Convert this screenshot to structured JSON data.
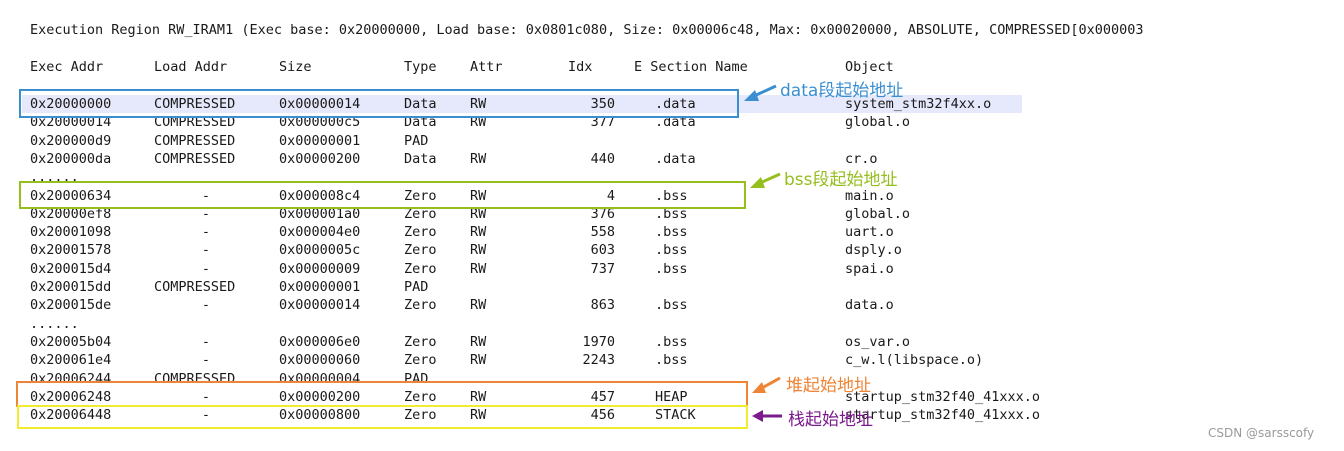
{
  "region_line": "Execution Region RW_IRAM1 (Exec base: 0x20000000, Load base: 0x0801c080, Size: 0x00006c48, Max: 0x00020000, ABSOLUTE, COMPRESSED[0x000003",
  "headers": [
    "Exec Addr",
    "Load Addr",
    "Size",
    "Type",
    "Attr",
    "Idx",
    "E Section Name",
    "Object"
  ],
  "rows": [
    {
      "exec": "0x20000000",
      "load": "COMPRESSED",
      "size": "0x00000014",
      "type": "Data",
      "attr": "RW",
      "idx": "350",
      "section": ".data",
      "object": "system_stm32f4xx.o"
    },
    {
      "exec": "0x20000014",
      "load": "COMPRESSED",
      "size": "0x000000c5",
      "type": "Data",
      "attr": "RW",
      "idx": "377",
      "section": ".data",
      "object": "global.o"
    },
    {
      "exec": "0x200000d9",
      "load": "COMPRESSED",
      "size": "0x00000001",
      "type": "PAD",
      "attr": "",
      "idx": "",
      "section": "",
      "object": ""
    },
    {
      "exec": "0x200000da",
      "load": "COMPRESSED",
      "size": "0x00000200",
      "type": "Data",
      "attr": "RW",
      "idx": "440",
      "section": ".data",
      "object": "cr.o"
    },
    {
      "exec": "......",
      "load": "",
      "size": "",
      "type": "",
      "attr": "",
      "idx": "",
      "section": "",
      "object": ""
    },
    {
      "exec": "0x20000634",
      "load": "-",
      "size": "0x000008c4",
      "type": "Zero",
      "attr": "RW",
      "idx": "4",
      "section": ".bss",
      "object": "main.o"
    },
    {
      "exec": "0x20000ef8",
      "load": "-",
      "size": "0x000001a0",
      "type": "Zero",
      "attr": "RW",
      "idx": "376",
      "section": ".bss",
      "object": "global.o"
    },
    {
      "exec": "0x20001098",
      "load": "-",
      "size": "0x000004e0",
      "type": "Zero",
      "attr": "RW",
      "idx": "558",
      "section": ".bss",
      "object": "uart.o"
    },
    {
      "exec": "0x20001578",
      "load": "-",
      "size": "0x0000005c",
      "type": "Zero",
      "attr": "RW",
      "idx": "603",
      "section": ".bss",
      "object": "dsply.o"
    },
    {
      "exec": "0x200015d4",
      "load": "-",
      "size": "0x00000009",
      "type": "Zero",
      "attr": "RW",
      "idx": "737",
      "section": ".bss",
      "object": "spai.o"
    },
    {
      "exec": "0x200015dd",
      "load": "COMPRESSED",
      "size": "0x00000001",
      "type": "PAD",
      "attr": "",
      "idx": "",
      "section": "",
      "object": ""
    },
    {
      "exec": "0x200015de",
      "load": "-",
      "size": "0x00000014",
      "type": "Zero",
      "attr": "RW",
      "idx": "863",
      "section": ".bss",
      "object": "data.o"
    },
    {
      "exec": "......",
      "load": "",
      "size": "",
      "type": "",
      "attr": "",
      "idx": "",
      "section": "",
      "object": ""
    },
    {
      "exec": "0x20005b04",
      "load": "-",
      "size": "0x000006e0",
      "type": "Zero",
      "attr": "RW",
      "idx": "1970",
      "section": ".bss",
      "object": "os_var.o"
    },
    {
      "exec": "0x200061e4",
      "load": "-",
      "size": "0x00000060",
      "type": "Zero",
      "attr": "RW",
      "idx": "2243",
      "section": ".bss",
      "object": "c_w.l(libspace.o)"
    },
    {
      "exec": "0x20006244",
      "load": "COMPRESSED",
      "size": "0x00000004",
      "type": "PAD",
      "attr": "",
      "idx": "",
      "section": "",
      "object": ""
    },
    {
      "exec": "0x20006248",
      "load": "-",
      "size": "0x00000200",
      "type": "Zero",
      "attr": "RW",
      "idx": "457",
      "section": "HEAP",
      "object": "startup_stm32f40_41xxx.o"
    },
    {
      "exec": "0x20006448",
      "load": "-",
      "size": "0x00000800",
      "type": "Zero",
      "attr": "RW",
      "idx": "456",
      "section": "STACK",
      "object": "startup_stm32f40_41xxx.o"
    }
  ],
  "annotations": {
    "data": {
      "label": "data段起始地址",
      "color": "#3b8fd1"
    },
    "bss": {
      "label": "bss段起始地址",
      "color": "#96be1e"
    },
    "heap": {
      "label": "堆起始地址",
      "color": "#ee8435"
    },
    "stack": {
      "label": "栈起始地址",
      "color": "#7b1a8c"
    }
  },
  "stack_box_color": "#f2ec2e",
  "footer": "CSDN @sarsscofy"
}
